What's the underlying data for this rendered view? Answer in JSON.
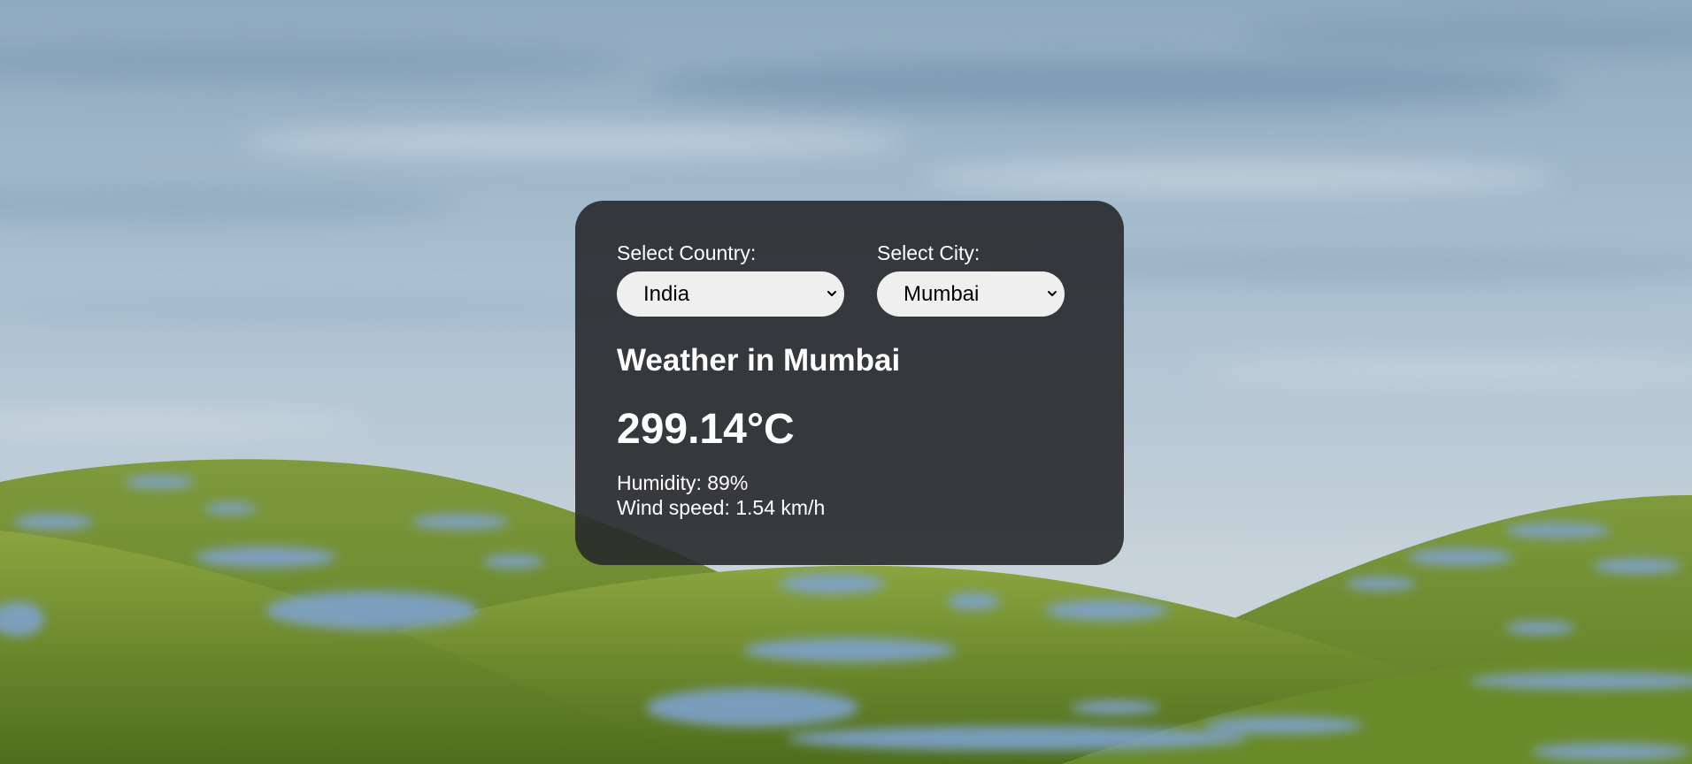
{
  "country_select": {
    "label": "Select Country:",
    "value": "India"
  },
  "city_select": {
    "label": "Select City:",
    "value": "Mumbai"
  },
  "weather": {
    "title": "Weather in Mumbai",
    "temperature": "299.14°C",
    "humidity": "Humidity: 89%",
    "wind_speed": "Wind speed: 1.54 km/h"
  },
  "icons": [
    "chevron-down-icon"
  ],
  "colors": {
    "card_background": "#28292b",
    "select_background": "#efefef",
    "text": "#ffffff"
  }
}
